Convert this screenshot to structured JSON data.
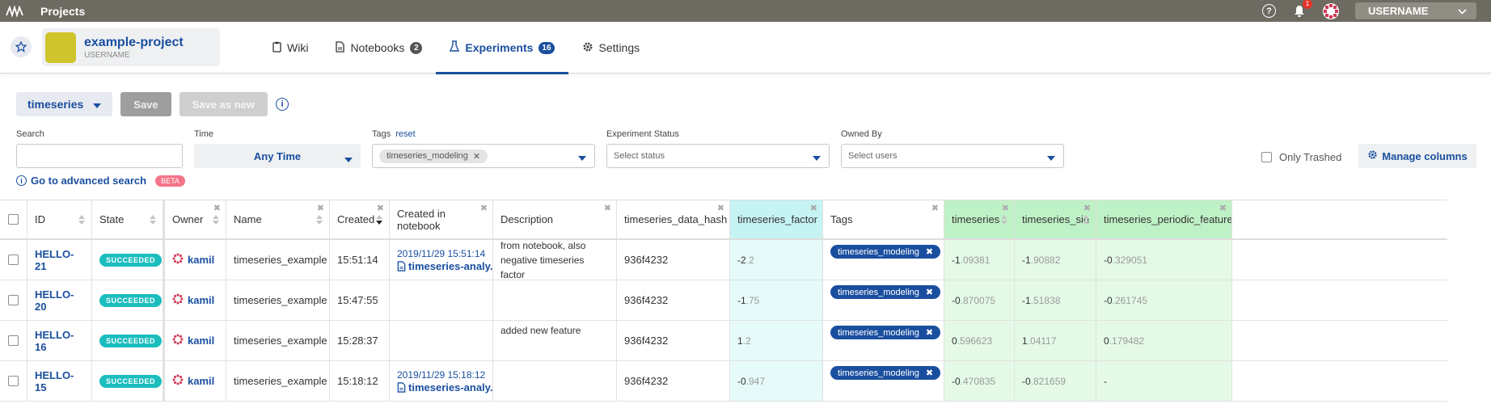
{
  "topbar": {
    "title": "Projects",
    "notifications_count": "1",
    "username": "USERNAME",
    "help_glyph": "?"
  },
  "project": {
    "name": "example-project",
    "owner": "USERNAME",
    "logo_color": "#cfc42c"
  },
  "tabs": [
    {
      "label": "Wiki",
      "icon": "clipboard-icon",
      "badge": ""
    },
    {
      "label": "Notebooks",
      "icon": "notebook-icon",
      "badge": "2"
    },
    {
      "label": "Experiments",
      "icon": "flask-icon",
      "badge": "16",
      "active": true
    },
    {
      "label": "Settings",
      "icon": "gear-icon",
      "badge": ""
    }
  ],
  "toolbar": {
    "view_name": "timeseries",
    "save_label": "Save",
    "save_as_new_label": "Save as new",
    "info_glyph": "i"
  },
  "filters": {
    "search_label": "Search",
    "search_value": "",
    "time_label": "Time",
    "time_value": "Any Time",
    "tags_label": "Tags",
    "tags_reset": "reset",
    "tags_selected": [
      "timeseries_modeling"
    ],
    "status_label": "Experiment Status",
    "status_placeholder": "Select status",
    "owner_label": "Owned By",
    "owner_placeholder": "Select users",
    "only_trashed_label": "Only Trashed",
    "manage_columns_label": "Manage columns",
    "advanced_search_label": "Go to advanced search",
    "beta_label": "BETA"
  },
  "table": {
    "columns": [
      "ID",
      "State",
      "Owner",
      "Name",
      "Created",
      "Created in notebook",
      "Description",
      "timeseries_data_hash",
      "timeseries_factor",
      "Tags",
      "timeseries",
      "timeseries_sin",
      "timeseries_periodic_feature"
    ],
    "rows": [
      {
        "id": "HELLO-21",
        "state": "SUCCEEDED",
        "owner": "kamil",
        "name": "timeseries_example",
        "created": "15:51:14",
        "nb_time": "2019/11/29 15:51:14",
        "nb_file": "timeseries-analy...",
        "description": "from notebook, also negative timeseries factor",
        "hash": "936f4232",
        "factor_int": "-2",
        "factor_frac": ".2",
        "tag": "timeseries_modeling",
        "ts_int": "-1",
        "ts_frac": ".09381",
        "sin_int": "-1",
        "sin_frac": ".90882",
        "per_int": "-0",
        "per_frac": ".329051"
      },
      {
        "id": "HELLO-20",
        "state": "SUCCEEDED",
        "owner": "kamil",
        "name": "timeseries_example",
        "created": "15:47:55",
        "nb_time": "",
        "nb_file": "",
        "description": "",
        "hash": "936f4232",
        "factor_int": "-1",
        "factor_frac": ".75",
        "tag": "timeseries_modeling",
        "ts_int": "-0",
        "ts_frac": ".870075",
        "sin_int": "-1",
        "sin_frac": ".51838",
        "per_int": "-0",
        "per_frac": ".261745"
      },
      {
        "id": "HELLO-16",
        "state": "SUCCEEDED",
        "owner": "kamil",
        "name": "timeseries_example",
        "created": "15:28:37",
        "nb_time": "",
        "nb_file": "",
        "description": "added new feature",
        "hash": "936f4232",
        "factor_int": "1",
        "factor_frac": ".2",
        "tag": "timeseries_modeling",
        "ts_int": "0",
        "ts_frac": ".596623",
        "sin_int": "1",
        "sin_frac": ".04117",
        "per_int": "0",
        "per_frac": ".179482"
      },
      {
        "id": "HELLO-15",
        "state": "SUCCEEDED",
        "owner": "kamil",
        "name": "timeseries_example",
        "created": "15:18:12",
        "nb_time": "2019/11/29 15:18:12",
        "nb_file": "timeseries-analy...",
        "description": "",
        "hash": "936f4232",
        "factor_int": "-0",
        "factor_frac": ".947",
        "tag": "timeseries_modeling",
        "ts_int": "-0",
        "ts_frac": ".470835",
        "sin_int": "-0",
        "sin_frac": ".821659",
        "per_int": "-",
        "per_frac": ""
      }
    ]
  },
  "colors": {
    "accent": "#1a4fa0",
    "topbar": "#6d6a61",
    "succeeded": "#1cbdbd",
    "cyan_col": "#c6f3f3",
    "green_col": "#bff1c6",
    "notification": "#e0352b"
  }
}
